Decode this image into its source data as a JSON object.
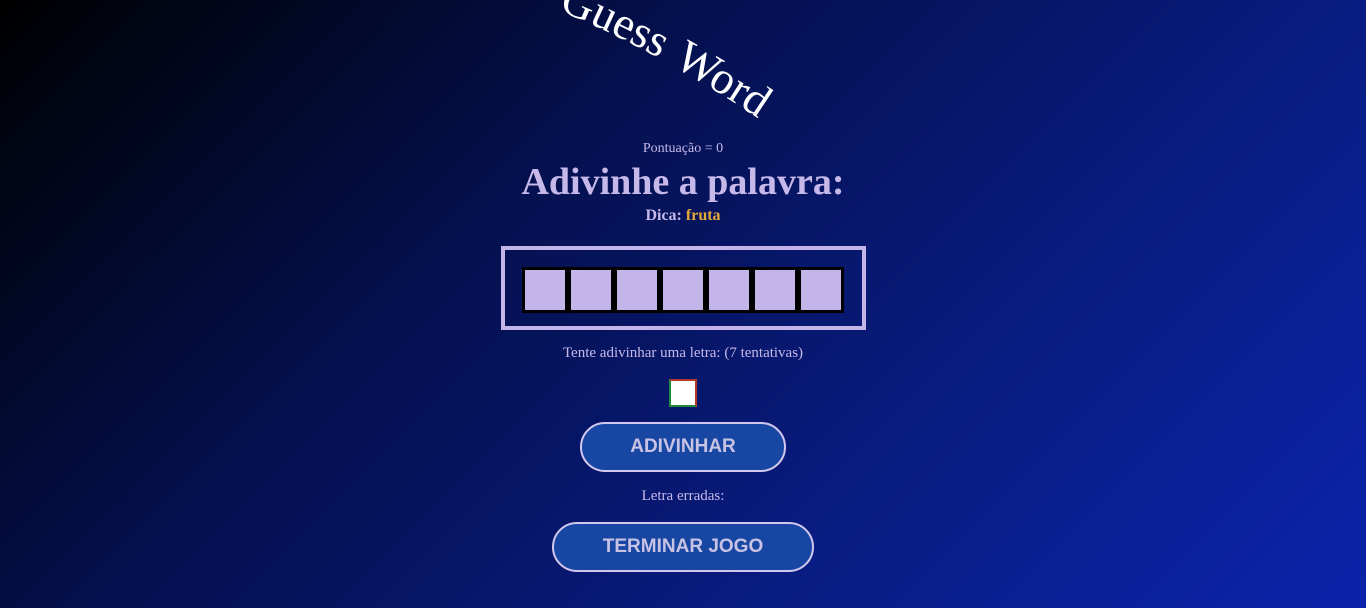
{
  "logo": {
    "line1": "Guess",
    "line2": "Word"
  },
  "score": {
    "label": "Pontuação",
    "separator": " = ",
    "value": "0"
  },
  "heading": "Adivinhe a palavra:",
  "hint": {
    "label": "Dica:",
    "value": "fruta"
  },
  "word": {
    "slot_count": 7,
    "slots": [
      "",
      "",
      "",
      "",
      "",
      "",
      ""
    ]
  },
  "prompt": {
    "text": "Tente adivinhar uma letra:",
    "attempts": "(7 tentativas)"
  },
  "letter_input": {
    "value": ""
  },
  "buttons": {
    "guess": "ADIVINHAR",
    "end": "TERMINAR JOGO"
  },
  "wrong_letters": {
    "label": "Letra erradas:",
    "letters": ""
  },
  "colors": {
    "accent": "#c7b8ea",
    "hint_value": "#e5a93a",
    "button_bg": "#1847a3",
    "slot_fill": "#c3b4ea"
  }
}
